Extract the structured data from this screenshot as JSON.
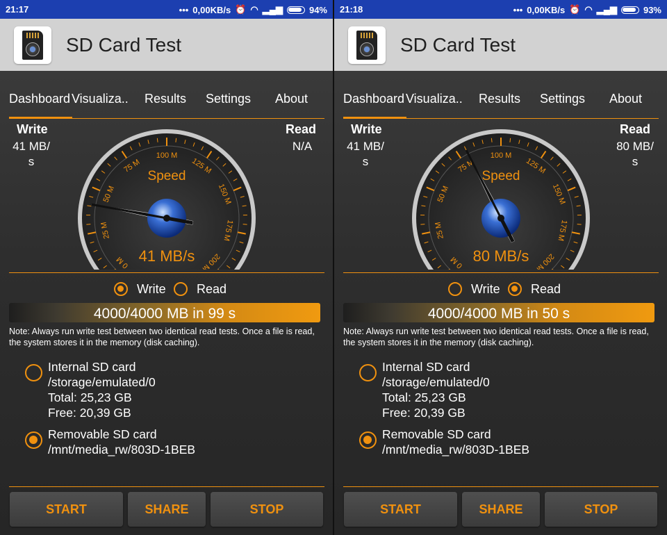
{
  "screens": [
    {
      "status": {
        "time": "21:17",
        "dots": "•••",
        "net": "0,00KB/s",
        "battery": "94%",
        "battery_level": 0.94
      },
      "app_title": "SD Card Test",
      "tabs": [
        "Dashboard",
        "Visualiza..",
        "Results",
        "Settings",
        "About"
      ],
      "write": {
        "label": "Write",
        "value_line1": "41 MB/",
        "value_line2": "s"
      },
      "read": {
        "label": "Read",
        "value_line1": "N/A",
        "value_line2": ""
      },
      "gauge": {
        "label": "Speed",
        "readout": "41 MB/s",
        "needle_value_mb": 41,
        "scale_labels": [
          "0 M",
          "25 M",
          "50 M",
          "75 M",
          "100 M",
          "125 M",
          "150 M",
          "175 M",
          "200 M"
        ]
      },
      "mode": {
        "write_label": "Write",
        "read_label": "Read",
        "selected": "write"
      },
      "progress": {
        "text": "4000/4000 MB in 99 s",
        "fraction": 1.0
      },
      "note": "Note: Always run write test between two identical read tests. Once a file is read, the system stores it in the memory (disk caching).",
      "storage": [
        {
          "lines": [
            "Internal SD card",
            "/storage/emulated/0",
            "Total: 25,23 GB",
            "Free: 20,39 GB"
          ],
          "selected": false
        },
        {
          "lines": [
            "Removable SD card",
            "/mnt/media_rw/803D-1BEB"
          ],
          "selected": true
        }
      ],
      "buttons": {
        "start": "START",
        "share": "SHARE",
        "stop": "STOP"
      }
    },
    {
      "status": {
        "time": "21:18",
        "dots": "•••",
        "net": "0,00KB/s",
        "battery": "93%",
        "battery_level": 0.93
      },
      "app_title": "SD Card Test",
      "tabs": [
        "Dashboard",
        "Visualiza..",
        "Results",
        "Settings",
        "About"
      ],
      "write": {
        "label": "Write",
        "value_line1": "41 MB/",
        "value_line2": "s"
      },
      "read": {
        "label": "Read",
        "value_line1": "80 MB/",
        "value_line2": "s"
      },
      "gauge": {
        "label": "Speed",
        "readout": "80 MB/s",
        "needle_value_mb": 80,
        "scale_labels": [
          "0 M",
          "25 M",
          "50 M",
          "75 M",
          "100 M",
          "125 M",
          "150 M",
          "175 M",
          "200 M"
        ]
      },
      "mode": {
        "write_label": "Write",
        "read_label": "Read",
        "selected": "read"
      },
      "progress": {
        "text": "4000/4000 MB in 50 s",
        "fraction": 1.0
      },
      "note": "Note: Always run write test between two identical read tests. Once a file is read, the system stores it in the memory (disk caching).",
      "storage": [
        {
          "lines": [
            "Internal SD card",
            "/storage/emulated/0",
            "Total: 25,23 GB",
            "Free: 20,39 GB"
          ],
          "selected": false
        },
        {
          "lines": [
            "Removable SD card",
            "/mnt/media_rw/803D-1BEB"
          ],
          "selected": true
        }
      ],
      "buttons": {
        "start": "START",
        "share": "SHARE",
        "stop": "STOP"
      }
    }
  ],
  "colors": {
    "accent": "#f0910f",
    "statusbar": "#1c3fb0",
    "appbar": "#d2d2d2"
  }
}
